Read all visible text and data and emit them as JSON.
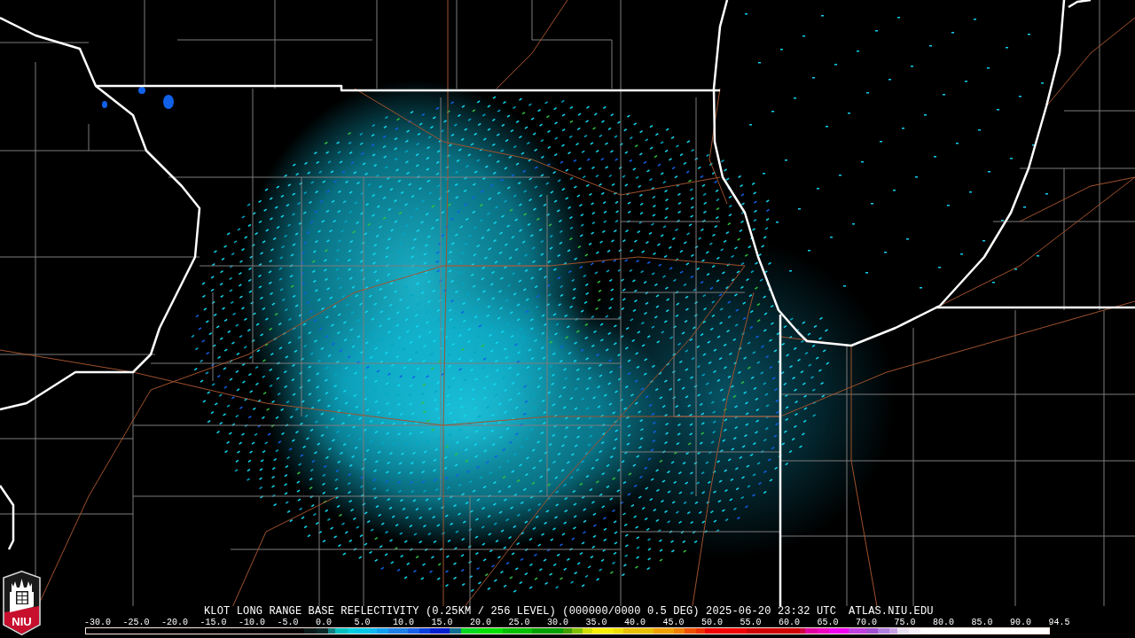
{
  "logo": {
    "text": "NIU"
  },
  "caption": {
    "product": "KLOT LONG RANGE BASE REFLECTIVITY (0.25KM / 256 LEVEL) (000000/0000 0.5 DEG) 2025-06-20 23:32 UTC",
    "source": "ATLAS.NIU.EDU"
  },
  "color_scale": {
    "labels": [
      "-30.0",
      "-25.0",
      "-20.0",
      "-15.0",
      "-10.0",
      "-5.0",
      "0.0",
      "5.0",
      "10.0",
      "15.0",
      "20.0",
      "25.0",
      "30.0",
      "35.0",
      "40.0",
      "45.0",
      "50.0",
      "55.0",
      "60.0",
      "65.0",
      "70.0",
      "75.0",
      "80.0",
      "85.0",
      "90.0",
      "94.5"
    ]
  }
}
